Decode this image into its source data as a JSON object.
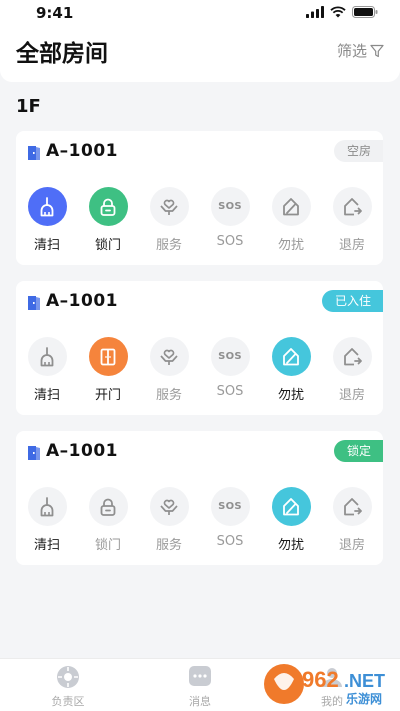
{
  "status_bar": {
    "time": "9:41"
  },
  "header": {
    "title": "全部房间",
    "filter_label": "筛选"
  },
  "floor": "1F",
  "rooms": [
    {
      "name": "A–1001",
      "status": "空房",
      "status_color": "#f0f1f3",
      "actions": [
        {
          "label": "清扫",
          "icon": "broom-icon",
          "active": true,
          "color": "#4f6ef7"
        },
        {
          "label": "锁门",
          "icon": "lock-icon",
          "active": true,
          "color": "#3ec083"
        },
        {
          "label": "服务",
          "icon": "service-icon",
          "active": false
        },
        {
          "label": "SOS",
          "icon": "sos-icon",
          "active": false
        },
        {
          "label": "勿扰",
          "icon": "do-not-disturb-icon",
          "active": false
        },
        {
          "label": "退房",
          "icon": "checkout-icon",
          "active": false
        }
      ]
    },
    {
      "name": "A–1001",
      "status": "已入住",
      "status_color": "#45c6dc",
      "actions": [
        {
          "label": "清扫",
          "icon": "broom-icon",
          "active": false
        },
        {
          "label": "开门",
          "icon": "open-door-icon",
          "active": true,
          "color": "#f5843c"
        },
        {
          "label": "服务",
          "icon": "service-icon",
          "active": false
        },
        {
          "label": "SOS",
          "icon": "sos-icon",
          "active": false
        },
        {
          "label": "勿扰",
          "icon": "do-not-disturb-icon",
          "active": true,
          "color": "#45c6dc"
        },
        {
          "label": "退房",
          "icon": "checkout-icon",
          "active": false
        }
      ]
    },
    {
      "name": "A–1001",
      "status": "锁定",
      "status_color": "#3ec083",
      "actions": [
        {
          "label": "清扫",
          "icon": "broom-icon",
          "active": false
        },
        {
          "label": "锁门",
          "icon": "lock-icon",
          "active": false
        },
        {
          "label": "服务",
          "icon": "service-icon",
          "active": false
        },
        {
          "label": "SOS",
          "icon": "sos-icon",
          "active": false
        },
        {
          "label": "勿扰",
          "icon": "do-not-disturb-icon",
          "active": true,
          "color": "#45c6dc"
        },
        {
          "label": "退房",
          "icon": "checkout-icon",
          "active": false
        }
      ]
    }
  ],
  "tabbar": [
    {
      "label": "负责区",
      "icon": "area-icon"
    },
    {
      "label": "消息",
      "icon": "message-icon"
    },
    {
      "label": "我的",
      "icon": "profile-icon"
    }
  ],
  "watermark": {
    "text": "962.NET",
    "subtext": "乐游网"
  }
}
